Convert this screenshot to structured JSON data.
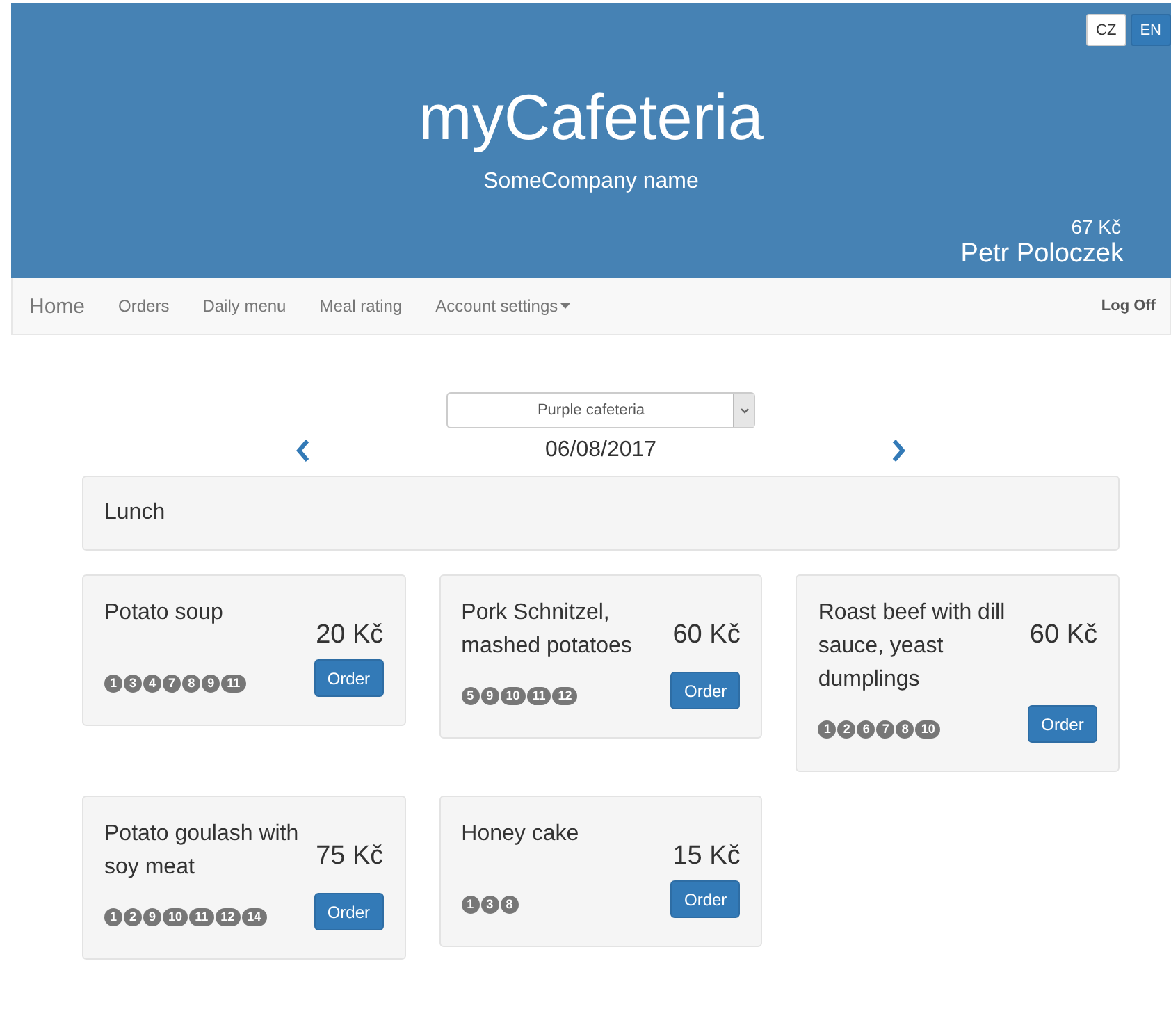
{
  "header": {
    "languages": [
      {
        "label": "CZ",
        "selected": true
      },
      {
        "label": "EN",
        "selected": false
      }
    ],
    "title": "myCafeteria",
    "company": "SomeCompany name",
    "balance": "67 Kč",
    "user": "Petr Poloczek"
  },
  "navbar": {
    "brand": "Home",
    "items": [
      {
        "label": "Orders",
        "kind": "link"
      },
      {
        "label": "Daily menu",
        "kind": "link"
      },
      {
        "label": "Meal rating",
        "kind": "link"
      },
      {
        "label": "Account settings",
        "kind": "dropdown"
      }
    ],
    "logoff": "Log Off"
  },
  "cafeteria_select": {
    "value": "Purple cafeteria"
  },
  "date": "06/08/2017",
  "section": "Lunch",
  "meals": [
    {
      "name": "Potato soup",
      "price": "20 Kč",
      "allergens": [
        "1",
        "3",
        "4",
        "7",
        "8",
        "9",
        "11"
      ],
      "button": "Order"
    },
    {
      "name": "Pork Schnitzel, mashed potatoes",
      "price": "60 Kč",
      "allergens": [
        "5",
        "9",
        "10",
        "11",
        "12"
      ],
      "button": "Order"
    },
    {
      "name": "Roast beef with dill sauce, yeast dumplings",
      "price": "60 Kč",
      "allergens": [
        "1",
        "2",
        "6",
        "7",
        "8",
        "10"
      ],
      "button": "Order"
    },
    {
      "name": "Potato goulash with soy meat",
      "price": "75 Kč",
      "allergens": [
        "1",
        "2",
        "9",
        "10",
        "11",
        "12",
        "14"
      ],
      "button": "Order"
    },
    {
      "name": "Honey cake",
      "price": "15 Kč",
      "allergens": [
        "1",
        "3",
        "8"
      ],
      "button": "Order"
    }
  ]
}
